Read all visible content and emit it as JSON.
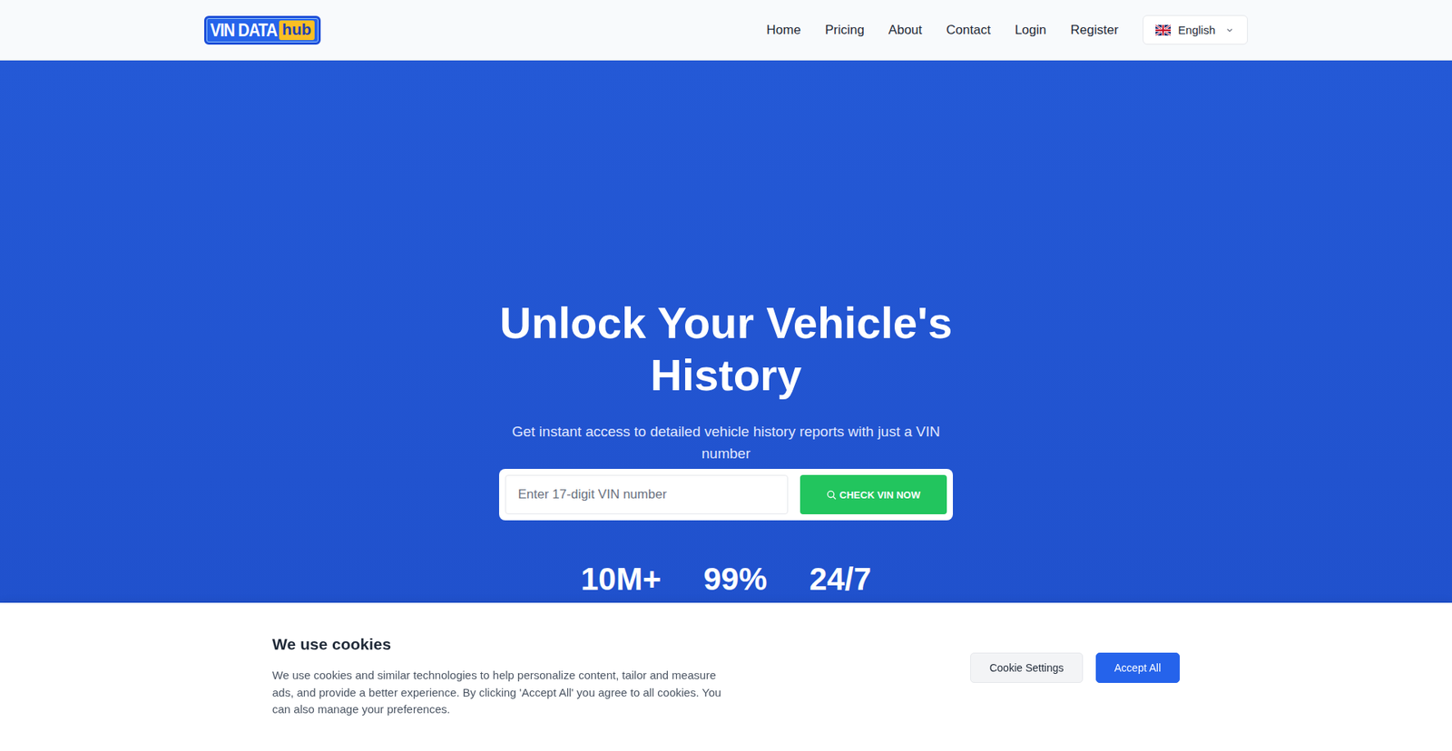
{
  "header": {
    "logo": {
      "main": "VIN DATA",
      "accent": "hub"
    },
    "nav": [
      {
        "label": "Home"
      },
      {
        "label": "Pricing"
      },
      {
        "label": "About"
      },
      {
        "label": "Contact"
      },
      {
        "label": "Login"
      },
      {
        "label": "Register"
      }
    ],
    "language": {
      "label": "English"
    }
  },
  "hero": {
    "title": "Unlock Your Vehicle's History",
    "subtitle": "Get instant access to detailed vehicle history reports with just a VIN number",
    "search": {
      "placeholder": "Enter 17-digit VIN number",
      "button": "CHECK VIN NOW"
    },
    "stats": [
      "10M+",
      "99%",
      "24/7"
    ]
  },
  "cookie_banner": {
    "title": "We use cookies",
    "text": "We use cookies and similar technologies to help personalize content, tailor and measure ads, and provide a better experience. By clicking 'Accept All' you agree to all cookies. You can also manage your preferences.",
    "buttons": [
      {
        "label": "Cookie Settings",
        "primary": false
      },
      {
        "label": "Accept All",
        "primary": true
      }
    ]
  }
}
